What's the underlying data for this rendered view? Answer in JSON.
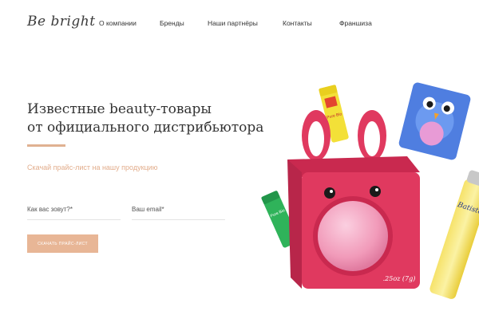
{
  "header": {
    "logo_text": "Be bright",
    "nav": [
      {
        "label": "О компании"
      },
      {
        "label": "Бренды"
      },
      {
        "label": "Наши партнёры"
      },
      {
        "label": "Контакты"
      },
      {
        "label": "Франшиза"
      }
    ]
  },
  "hero": {
    "title_line1": "Известные beauty-товары",
    "title_line2": "от официального дистрибьютора",
    "price_link": "Скачай прайс-лист на нашу продукцию",
    "name_placeholder": "Как вас зовут?*",
    "email_placeholder": "Ваш email*",
    "cta_label": "Скачать прайс-лист",
    "product_weight_label": ".25oz (7g)",
    "product_labels": {
      "tube_yellow": "Pure Bio",
      "tube_green": "Pure Bio",
      "spray": "Batiste"
    }
  },
  "colors": {
    "accent": "#e0b191",
    "button": "#e8b696",
    "box": "#e0395f",
    "blush": "#f4a7c0"
  }
}
